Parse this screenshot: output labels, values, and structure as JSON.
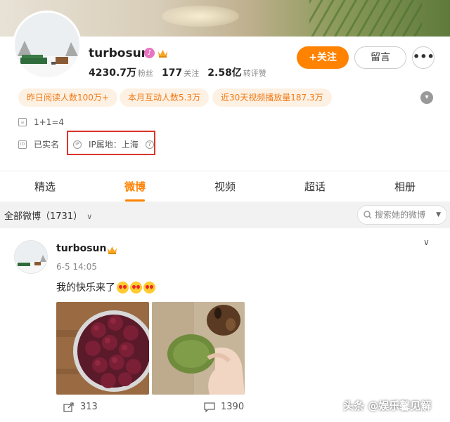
{
  "profile": {
    "username": "turbosun",
    "followers_value": "4230.7万",
    "followers_label": "粉丝",
    "following_value": "177",
    "following_label": "关注",
    "likes_value": "2.58亿",
    "likes_label": "转评赞",
    "follow_button": "+关注",
    "message_button": "留言",
    "more_button": "•••",
    "stat_pills": [
      "昨日阅读人数100万+",
      "本月互动人数5.3万",
      "近30天视频播放量187.3万"
    ],
    "bio": "1+1=4",
    "verified_text": "已实名",
    "ip_location": "IP属地：上海"
  },
  "tabs": [
    {
      "label": "精选",
      "active": false
    },
    {
      "label": "微博",
      "active": true
    },
    {
      "label": "视频",
      "active": false
    },
    {
      "label": "超话",
      "active": false
    },
    {
      "label": "相册",
      "active": false
    }
  ],
  "filter": {
    "label": "全部微博（1731）",
    "search_placeholder": "搜索她的微博"
  },
  "post": {
    "username": "turbosun",
    "time": "6-5 14:05",
    "text": "我的快乐来了",
    "emoji_count": 3,
    "repost_count": "313",
    "comment_count": "1390"
  },
  "watermark": "头条 @娱乐馨见解",
  "colors": {
    "accent": "#ff8200",
    "highlight_box": "#d9362a",
    "pill_bg": "#fdf1e4",
    "pill_text": "#f07a15"
  }
}
